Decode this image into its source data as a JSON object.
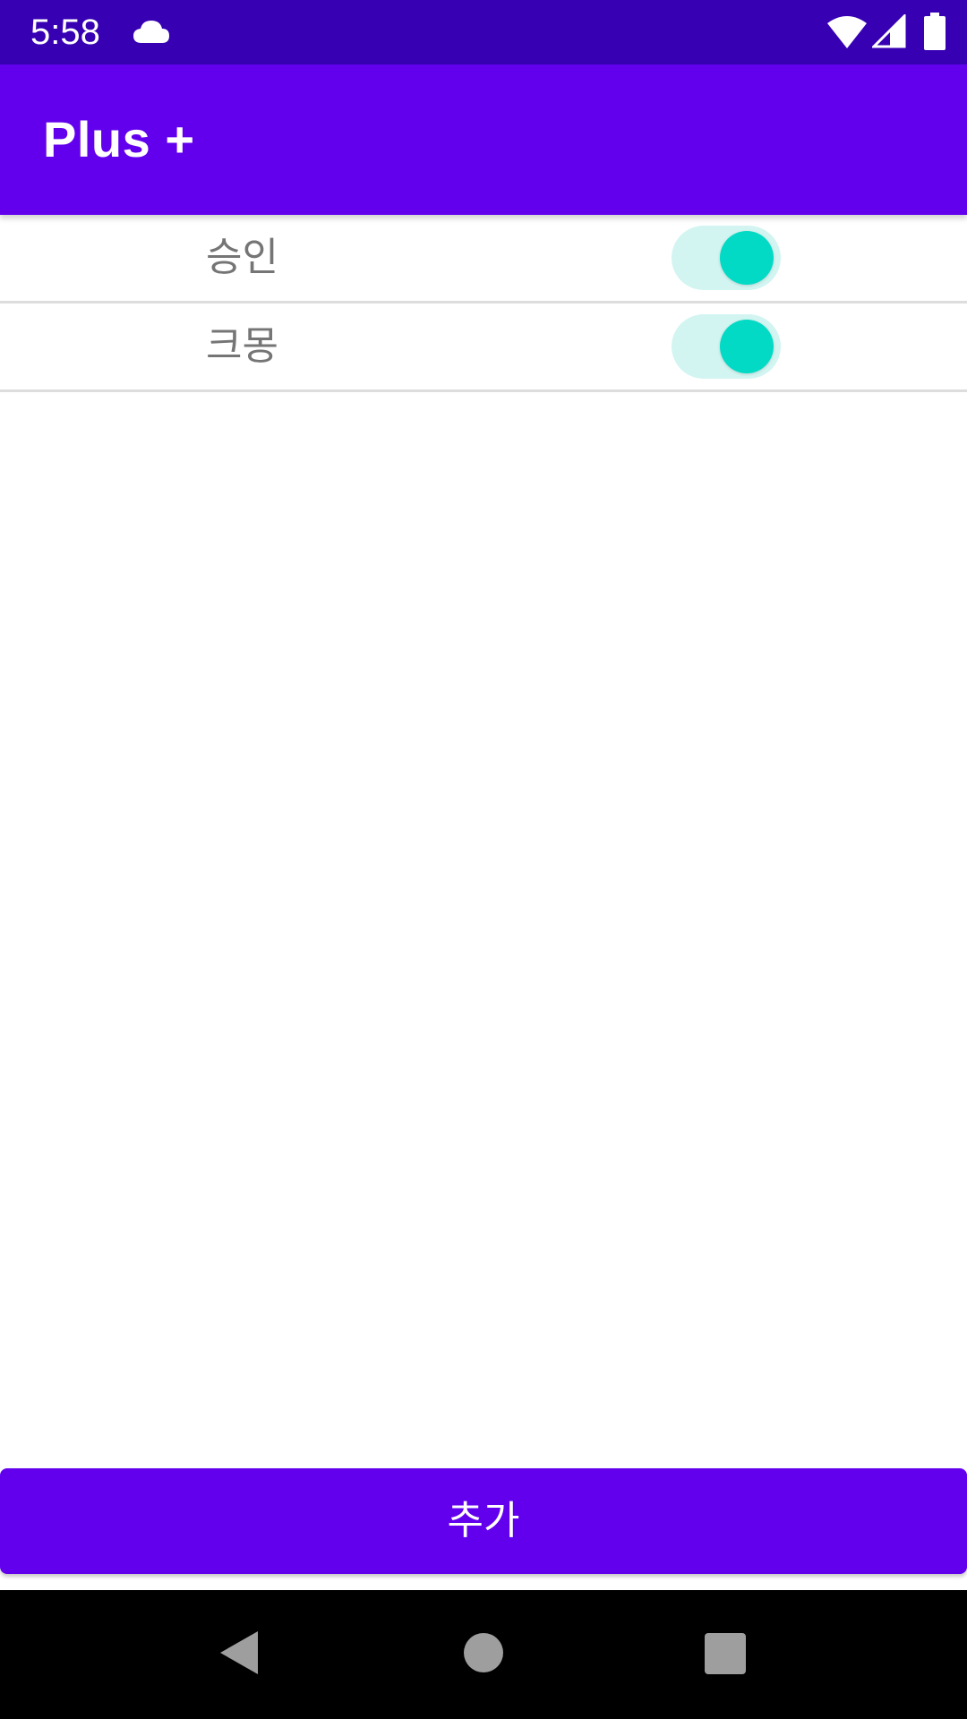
{
  "status_bar": {
    "time": "5:58",
    "icons": [
      "cloud-icon",
      "wifi-icon",
      "signal-icon",
      "battery-icon"
    ]
  },
  "app_bar": {
    "title": "Plus +"
  },
  "list": {
    "items": [
      {
        "label": "승인",
        "switch_on": true
      },
      {
        "label": "크몽",
        "switch_on": true
      }
    ]
  },
  "add_button": {
    "label": "추가"
  },
  "nav_bar": {
    "icons": [
      "back-icon",
      "home-icon",
      "recents-icon"
    ]
  },
  "colors": {
    "status_bar": "#3700b3",
    "primary": "#6200ee",
    "accent": "#03dac5",
    "switch_track": "#d2f5f2",
    "label_text": "#757575",
    "nav_bar": "#000000"
  }
}
